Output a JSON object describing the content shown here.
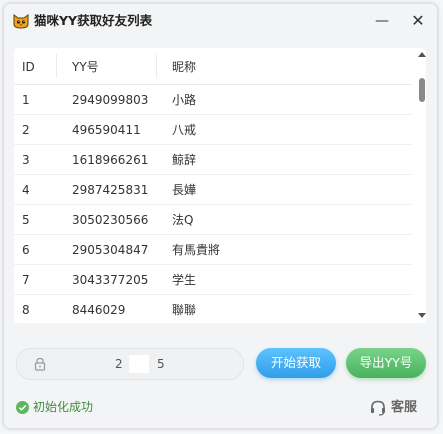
{
  "window": {
    "title": "猫咪YY获取好友列表",
    "minimize_label": "—",
    "close_label": "✕",
    "app_icon": "cat-face-icon"
  },
  "table": {
    "headers": {
      "id": "ID",
      "yy": "YY号",
      "nickname": "昵称"
    },
    "rows": [
      {
        "id": "1",
        "yy": "2949099803",
        "nickname": "小路"
      },
      {
        "id": "2",
        "yy": "496590411",
        "nickname": "八戒"
      },
      {
        "id": "3",
        "yy": "1618966261",
        "nickname": "鲸辞"
      },
      {
        "id": "4",
        "yy": "2987425831",
        "nickname": "長嬅"
      },
      {
        "id": "5",
        "yy": "3050230566",
        "nickname": "法Q"
      },
      {
        "id": "6",
        "yy": "2905304847",
        "nickname": "有馬貴將"
      },
      {
        "id": "7",
        "yy": "3043377205",
        "nickname": "学生"
      },
      {
        "id": "8",
        "yy": "8446029",
        "nickname": "聯聯"
      }
    ]
  },
  "code_field": {
    "value_part1": "2",
    "value_part2": "5",
    "icon": "lock-icon"
  },
  "buttons": {
    "start": "开始获取",
    "export": "导出YY号"
  },
  "status": {
    "text": "初始化成功",
    "icon": "check-circle-icon"
  },
  "support": {
    "label": "客服",
    "icon": "headset-icon"
  },
  "colors": {
    "start_button": "#2f9ee8",
    "export_button": "#49b25e",
    "status_ok": "#5cb85c"
  }
}
